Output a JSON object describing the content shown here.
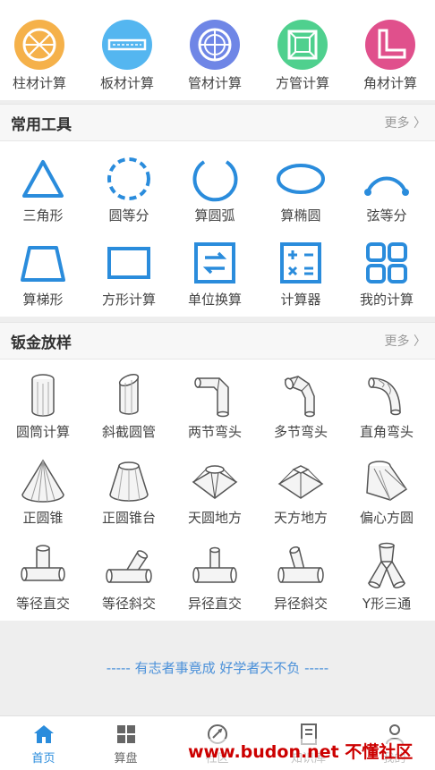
{
  "top_tools": [
    {
      "label": "柱材计算",
      "color": "#f5b14a",
      "icon": "column-icon"
    },
    {
      "label": "板材计算",
      "color": "#54b6f0",
      "icon": "plate-icon"
    },
    {
      "label": "管材计算",
      "color": "#6f86e6",
      "icon": "pipe-icon"
    },
    {
      "label": "方管计算",
      "color": "#4fd08e",
      "icon": "square-tube-icon"
    },
    {
      "label": "角材计算",
      "color": "#e0508c",
      "icon": "angle-icon"
    }
  ],
  "common_tools": {
    "title": "常用工具",
    "more": "更多",
    "items": [
      {
        "label": "三角形",
        "icon": "triangle-icon"
      },
      {
        "label": "圆等分",
        "icon": "dashed-circle-icon"
      },
      {
        "label": "算圆弧",
        "icon": "arc-icon"
      },
      {
        "label": "算椭圆",
        "icon": "ellipse-icon"
      },
      {
        "label": "弦等分",
        "icon": "chord-icon"
      },
      {
        "label": "算梯形",
        "icon": "trapezoid-icon"
      },
      {
        "label": "方形计算",
        "icon": "rectangle-icon"
      },
      {
        "label": "单位换算",
        "icon": "unit-convert-icon"
      },
      {
        "label": "计算器",
        "icon": "calculator-icon"
      },
      {
        "label": "我的计算",
        "icon": "grid-icon"
      }
    ]
  },
  "sheet_metal": {
    "title": "钣金放样",
    "more": "更多",
    "items": [
      {
        "label": "圆筒计算",
        "icon": "cylinder-icon"
      },
      {
        "label": "斜截圆管",
        "icon": "oblique-pipe-icon"
      },
      {
        "label": "两节弯头",
        "icon": "two-elbow-icon"
      },
      {
        "label": "多节弯头",
        "icon": "multi-elbow-icon"
      },
      {
        "label": "直角弯头",
        "icon": "right-elbow-icon"
      },
      {
        "label": "正圆锥",
        "icon": "cone-icon"
      },
      {
        "label": "正圆锥台",
        "icon": "frustum-icon"
      },
      {
        "label": "天圆地方",
        "icon": "round-square-icon"
      },
      {
        "label": "天方地方",
        "icon": "square-square-icon"
      },
      {
        "label": "偏心方圆",
        "icon": "eccentric-icon"
      },
      {
        "label": "等径直交",
        "icon": "equal-tee-icon"
      },
      {
        "label": "等径斜交",
        "icon": "equal-oblique-tee-icon"
      },
      {
        "label": "异径直交",
        "icon": "reducing-tee-icon"
      },
      {
        "label": "异径斜交",
        "icon": "reducing-oblique-tee-icon"
      },
      {
        "label": "Y形三通",
        "icon": "y-tee-icon"
      }
    ]
  },
  "motto": "----- 有志者事竟成 好学者天不负 -----",
  "tabbar": [
    {
      "label": "首页",
      "icon": "home-icon"
    },
    {
      "label": "算盘",
      "icon": "apps-icon"
    },
    {
      "label": "社区",
      "icon": "community-icon"
    },
    {
      "label": "知识库",
      "icon": "book-icon"
    },
    {
      "label": "我的",
      "icon": "user-icon"
    }
  ],
  "watermark": "www.budon.net 不懂社区",
  "accent": "#2a8cdc"
}
